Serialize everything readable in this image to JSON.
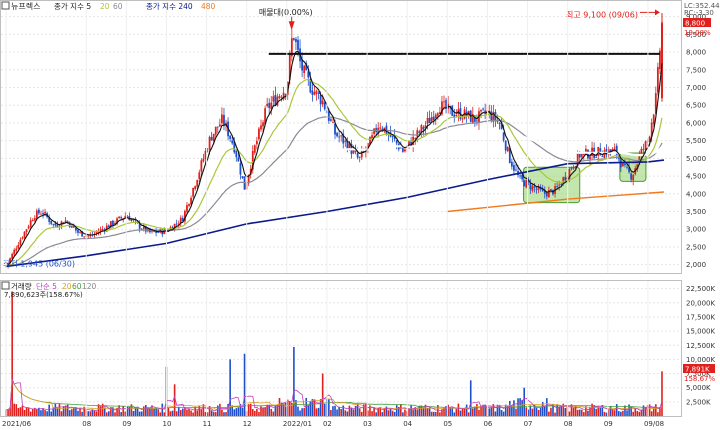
{
  "price_legend": {
    "name": "뉴프렉스",
    "ma_label": "종가 지수 5",
    "ma_20": "20",
    "ma_60": "60",
    "ma2_label": "종가 지수 240",
    "ma2_480": "480"
  },
  "volume_legend": {
    "title": "거래량",
    "ma_label": "단순 5",
    "ma_20": "20",
    "ma_60": "60",
    "ma_120": "120",
    "value_line": "7,890,623주(158.67%)"
  },
  "annotations": {
    "high_text": "최고 9,100 (09/06)",
    "resistance_text": "매물대(0.00%)",
    "low_text": "최저 1,945 (06/30)",
    "last_price": "8,800",
    "pct_change": "19.08%",
    "lc_line": "LC:352.44",
    "rc_line": "RC:-3.30",
    "volume_tag": "7,891K",
    "volume_pct": "158.67%"
  },
  "colors": {
    "up": "#e0201c",
    "down": "#1f4fc9",
    "ma5": "#111111",
    "ma20": "#a8c83a",
    "ma60": "#8a8a96",
    "ma120": "#ffffff",
    "ma240": "#0a1a8a",
    "ma480": "#f07a20",
    "highlight": "#8fd16a"
  },
  "chart_data": [
    {
      "type": "line",
      "title": "",
      "y_unit": "원",
      "ylim": [
        1850,
        9300
      ],
      "y_ticks": [
        "2,000",
        "2,500",
        "3,000",
        "3,500",
        "4,000",
        "4,500",
        "5,000",
        "5,500",
        "6,000",
        "6,500",
        "7,000",
        "7,500",
        "8,000",
        "8,500",
        "9,000"
      ],
      "x_tick_labels": [
        "2021/06",
        "08",
        "09",
        "10",
        "11",
        "12",
        "2022/01",
        "02",
        "03",
        "04",
        "05",
        "06",
        "07",
        "08",
        "09",
        "09/08"
      ],
      "x_tick_months": [
        0,
        2,
        3,
        4,
        5,
        6,
        7,
        8,
        9,
        10,
        11,
        12,
        13,
        14,
        15,
        16
      ],
      "date_axis": "month index from 2021/06",
      "close_path": [
        [
          0.0,
          1950
        ],
        [
          0.3,
          2600
        ],
        [
          0.7,
          3400
        ],
        [
          0.9,
          3500
        ],
        [
          1.2,
          3100
        ],
        [
          1.5,
          3250
        ],
        [
          1.8,
          2900
        ],
        [
          2.1,
          2800
        ],
        [
          2.4,
          3000
        ],
        [
          2.7,
          3200
        ],
        [
          3.0,
          3400
        ],
        [
          3.3,
          3100
        ],
        [
          3.6,
          2900
        ],
        [
          4.0,
          2950
        ],
        [
          4.4,
          3300
        ],
        [
          4.8,
          4600
        ],
        [
          5.1,
          5600
        ],
        [
          5.4,
          6100
        ],
        [
          5.7,
          5300
        ],
        [
          5.95,
          4150
        ],
        [
          6.2,
          5300
        ],
        [
          6.5,
          6400
        ],
        [
          6.8,
          6800
        ],
        [
          7.0,
          7000
        ],
        [
          7.15,
          8600
        ],
        [
          7.35,
          7600
        ],
        [
          7.6,
          7000
        ],
        [
          7.9,
          6600
        ],
        [
          8.2,
          5700
        ],
        [
          8.5,
          5400
        ],
        [
          8.8,
          4950
        ],
        [
          9.1,
          5500
        ],
        [
          9.3,
          6000
        ],
        [
          9.6,
          5600
        ],
        [
          9.9,
          5200
        ],
        [
          10.2,
          5600
        ],
        [
          10.5,
          6000
        ],
        [
          10.8,
          6500
        ],
        [
          11.1,
          6300
        ],
        [
          11.4,
          6250
        ],
        [
          11.7,
          6100
        ],
        [
          12.0,
          6300
        ],
        [
          12.3,
          6000
        ],
        [
          12.55,
          5000
        ],
        [
          12.8,
          4400
        ],
        [
          13.1,
          4200
        ],
        [
          13.4,
          4000
        ],
        [
          13.7,
          4100
        ],
        [
          14.0,
          4600
        ],
        [
          14.3,
          5100
        ],
        [
          14.6,
          5150
        ],
        [
          14.9,
          5200
        ],
        [
          15.2,
          5200
        ],
        [
          15.4,
          4700
        ],
        [
          15.6,
          4500
        ],
        [
          15.8,
          5100
        ],
        [
          16.0,
          5500
        ],
        [
          16.2,
          6700
        ],
        [
          16.35,
          8800
        ]
      ],
      "ma240_path": [
        [
          0.0,
          1950
        ],
        [
          2.0,
          2250
        ],
        [
          4.0,
          2600
        ],
        [
          6.0,
          3150
        ],
        [
          8.0,
          3500
        ],
        [
          10.0,
          3900
        ],
        [
          12.0,
          4400
        ],
        [
          14.0,
          4850
        ],
        [
          16.0,
          4900
        ],
        [
          16.4,
          4950
        ]
      ],
      "ma480_path": [
        [
          11.0,
          3500
        ],
        [
          14.0,
          3850
        ],
        [
          16.4,
          4050
        ]
      ],
      "resistance_level": 7950,
      "high": 9100,
      "low": 1945
    },
    {
      "type": "bar",
      "title": "",
      "ylim": [
        0,
        23500
      ],
      "y_unit": "K shares",
      "y_ticks": [
        "2,500K",
        "5,000K",
        "7,500K",
        "10,000K",
        "12,500K",
        "15,000K",
        "17,500K",
        "20,000K",
        "22,500K"
      ],
      "notable_bars": [
        {
          "month": 0.15,
          "value": 22000
        },
        {
          "month": 4.0,
          "value": 8700
        },
        {
          "month": 4.2,
          "value": 5600
        },
        {
          "month": 5.6,
          "value": 10000
        },
        {
          "month": 5.95,
          "value": 11000
        },
        {
          "month": 7.15,
          "value": 12200
        },
        {
          "month": 7.9,
          "value": 7500
        },
        {
          "month": 11.6,
          "value": 6300
        },
        {
          "month": 12.9,
          "value": 5000
        },
        {
          "month": 16.35,
          "value": 7891
        }
      ]
    }
  ]
}
